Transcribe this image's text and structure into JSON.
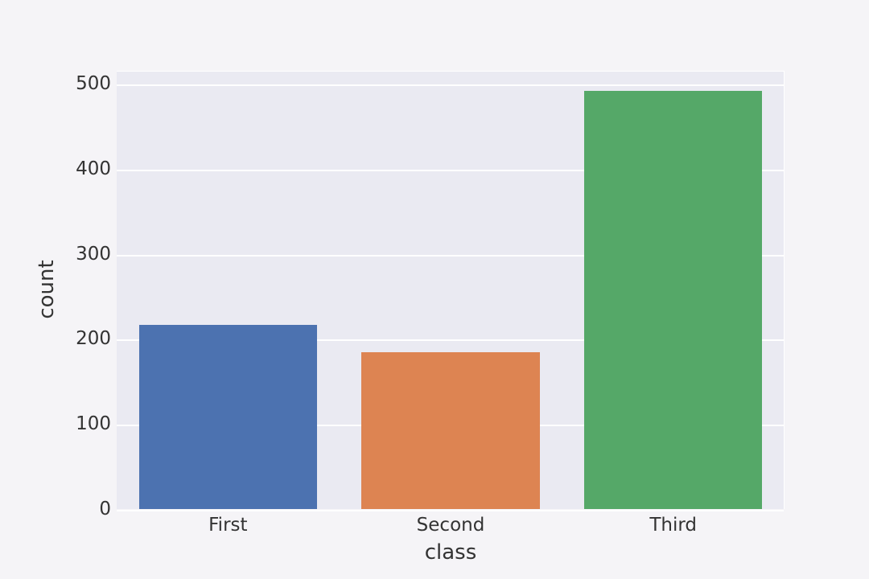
{
  "chart_data": {
    "type": "bar",
    "categories": [
      "First",
      "Second",
      "Third"
    ],
    "values": [
      216,
      184,
      491
    ],
    "colors": [
      "#4c72b0",
      "#dd8452",
      "#55a868"
    ],
    "title": "",
    "xlabel": "class",
    "ylabel": "count",
    "ylim": [
      0,
      515
    ],
    "yticks": [
      0,
      100,
      200,
      300,
      400,
      500
    ]
  }
}
